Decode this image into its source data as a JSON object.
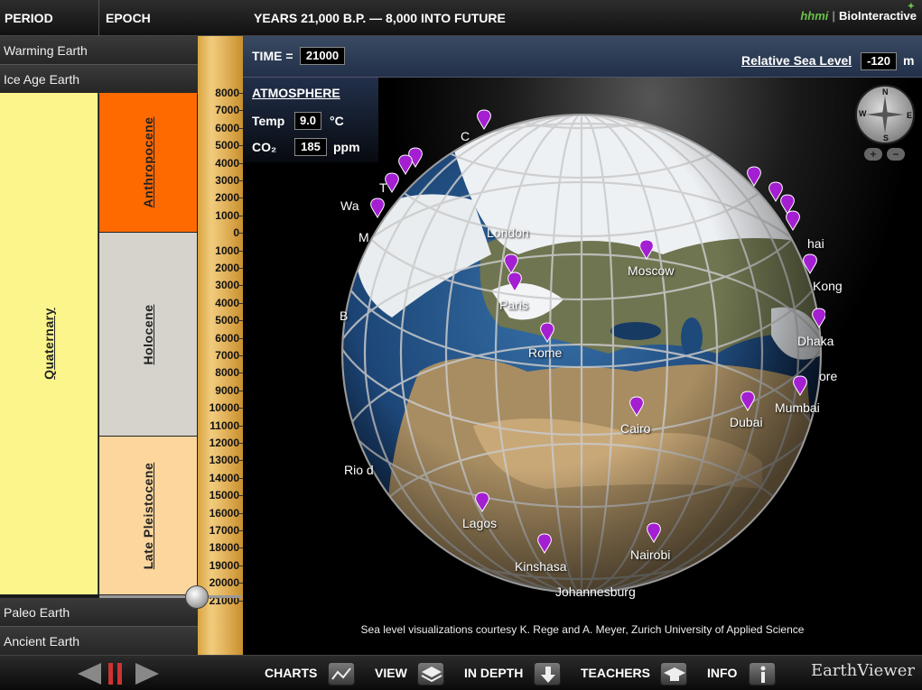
{
  "header": {
    "period_label": "PERIOD",
    "epoch_label": "EPOCH",
    "years_label": "YEARS 21,000 B.P. — 8,000 INTO FUTURE",
    "brand_hhmi": "hhmi",
    "brand_biointeractive": "BioInteractive"
  },
  "sidebar": {
    "nav_top": [
      "Warming Earth",
      "Ice Age Earth"
    ],
    "nav_bottom": [
      "Paleo Earth",
      "Ancient Earth"
    ],
    "period": "Quaternary",
    "epochs": [
      {
        "name": "Anthropocene",
        "color": "#ff6a00"
      },
      {
        "name": "Holocene",
        "color": "#d6d3cc"
      },
      {
        "name": "Late Pleistocene",
        "color": "#fcd69d"
      }
    ],
    "period_color": "#fbf58c"
  },
  "ruler": {
    "ticks": [
      "8000",
      "7000",
      "6000",
      "5000",
      "4000",
      "3000",
      "2000",
      "1000",
      "0",
      "1000",
      "2000",
      "3000",
      "4000",
      "5000",
      "6000",
      "7000",
      "8000",
      "9000",
      "10000",
      "11000",
      "12000",
      "13000",
      "14000",
      "15000",
      "16000",
      "17000",
      "18000",
      "19000",
      "20000",
      "21000"
    ],
    "slider_value": 21000
  },
  "panel": {
    "time_label": "TIME =",
    "time_value": "21000",
    "sea_level_label": "Relative Sea Level",
    "sea_level_value": "-120",
    "sea_level_unit": "m",
    "atmosphere_label": "ATMOSPHERE",
    "temp_label": "Temp",
    "temp_value": "9.0",
    "temp_unit": "°C",
    "co2_label": "CO₂",
    "co2_value": "185",
    "co2_unit": "ppm"
  },
  "compass": {
    "n": "N",
    "s": "S",
    "e": "E",
    "w": "W",
    "zoom_in": "+",
    "zoom_out": "−"
  },
  "cities": [
    "London",
    "Paris",
    "Rome",
    "Moscow",
    "Cairo",
    "Dubai",
    "Mumbai",
    "Dhaka",
    "Lagos",
    "Kinshasa",
    "Nairobi",
    "Johannesburg",
    "Rio d",
    "Kong",
    "ore",
    "hai",
    "M",
    "B",
    "C",
    "T",
    "Wa"
  ],
  "credit": "Sea level visualizations courtesy K. Rege and A. Meyer, Zurich University of Applied Science",
  "bottom": {
    "charts": "CHARTS",
    "view": "VIEW",
    "in_depth": "IN DEPTH",
    "teachers": "TEACHERS",
    "info": "INFO",
    "app_name": "EarthViewer"
  },
  "colors": {
    "marker": "#a41fd1",
    "ocean": "#1e4f84",
    "ice": "#f2f4f6"
  }
}
